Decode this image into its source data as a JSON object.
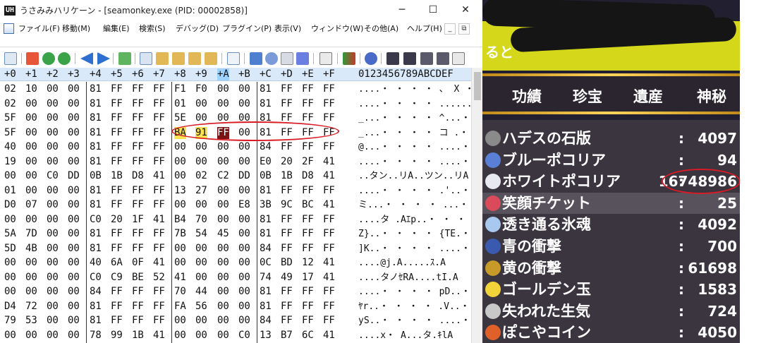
{
  "window": {
    "app_icon": "UH",
    "title": "うさみみハリケーン - [seamonkey.exe (PID: 00002858)]",
    "controls": [
      "─",
      "☐",
      "✕"
    ]
  },
  "menu": {
    "items": [
      "ファイル(F)",
      "移動(M)",
      "編集(E)",
      "検索(S)",
      "デバッグ(D)",
      "プラグイン(P)",
      "表示(V)",
      "ウィンドウ(W)",
      "その他(A)",
      "ヘルプ(H)"
    ],
    "mdi": [
      "_",
      "⧉"
    ]
  },
  "toolbar": {
    "icons": [
      "compare-icon",
      "marker-icon",
      "back-icon",
      "forward-icon",
      "prev-icon",
      "next-icon",
      "refresh-icon",
      "copy-icon",
      "paste-icon",
      "paste-special-icon",
      "paste-text-icon",
      "paste-hex-icon",
      "font-icon",
      "edit-icon",
      "settings-icon",
      "code-icon",
      "calc-icon",
      "calculator-icon",
      "color-icon",
      "plugin-icon",
      "binoculars-icon",
      "binoculars-next-icon",
      "replace-icon",
      "find-text-icon",
      "binary-icon"
    ]
  },
  "hex_header": {
    "columns": [
      "+0",
      "+1",
      "+2",
      "+3",
      "+4",
      "+5",
      "+6",
      "+7",
      "+8",
      "+9",
      "+A",
      "+B",
      "+C",
      "+D",
      "+E",
      "+F"
    ],
    "ascii": "0123456789ABCDEF"
  },
  "hex_rows": [
    {
      "bytes": [
        "02",
        "10",
        "00",
        "00",
        "81",
        "FF",
        "FF",
        "FF",
        "F1",
        "F0",
        "00",
        "00",
        "81",
        "FF",
        "FF",
        "FF"
      ],
      "ascii": "....・ ・ ・ ・ 、 X ・ ・ ・"
    },
    {
      "bytes": [
        "02",
        "00",
        "00",
        "00",
        "81",
        "FF",
        "FF",
        "FF",
        "01",
        "00",
        "00",
        "00",
        "81",
        "FF",
        "FF",
        "FF"
      ],
      "ascii": "....・ ・ ・ ・ .......・ ・ ・"
    },
    {
      "bytes": [
        "5F",
        "00",
        "00",
        "00",
        "81",
        "FF",
        "FF",
        "FF",
        "5E",
        "00",
        "00",
        "00",
        "81",
        "FF",
        "FF",
        "FF"
      ],
      "ascii": "_...・ ・ ・ ・ ^...・ ・ ・"
    },
    {
      "bytes": [
        "5F",
        "00",
        "00",
        "00",
        "81",
        "FF",
        "FF",
        "FF",
        "BA",
        "91",
        "FF",
        "00",
        "81",
        "FF",
        "FF",
        "FF"
      ],
      "ascii": "_...・ ・ ・ ・ コ .・ .・ ・ ・"
    },
    {
      "bytes": [
        "40",
        "00",
        "00",
        "00",
        "81",
        "FF",
        "FF",
        "FF",
        "00",
        "00",
        "00",
        "00",
        "84",
        "FF",
        "FF",
        "FF"
      ],
      "ascii": "@...・ ・ ・ ・ ....・ ・ ・ ・"
    },
    {
      "bytes": [
        "19",
        "00",
        "00",
        "00",
        "81",
        "FF",
        "FF",
        "FF",
        "00",
        "00",
        "00",
        "00",
        "E0",
        "20",
        "2F",
        "41"
      ],
      "ascii": "....・ ・ ・ ・ ....・ /A"
    },
    {
      "bytes": [
        "00",
        "00",
        "C0",
        "DD",
        "0B",
        "1B",
        "D8",
        "41",
        "00",
        "02",
        "C2",
        "DD",
        "0B",
        "1B",
        "D8",
        "41"
      ],
      "ascii": "..タン..リA..ツン..リA"
    },
    {
      "bytes": [
        "01",
        "00",
        "00",
        "00",
        "81",
        "FF",
        "FF",
        "FF",
        "13",
        "27",
        "00",
        "00",
        "81",
        "FF",
        "FF",
        "FF"
      ],
      "ascii": "....・ ・ ・ ・ .'..・ ・ ・"
    },
    {
      "bytes": [
        "D0",
        "07",
        "00",
        "00",
        "81",
        "FF",
        "FF",
        "FF",
        "00",
        "00",
        "00",
        "E8",
        "3B",
        "9C",
        "BC",
        "41"
      ],
      "ascii": "ミ...・ ・ ・ ・ ...・ ;悠A"
    },
    {
      "bytes": [
        "00",
        "00",
        "00",
        "00",
        "C0",
        "20",
        "1F",
        "41",
        "B4",
        "70",
        "00",
        "00",
        "81",
        "FF",
        "FF",
        "FF"
      ],
      "ascii": "....タ .Aｴp..・ ・ ・"
    },
    {
      "bytes": [
        "5A",
        "7D",
        "00",
        "00",
        "81",
        "FF",
        "FF",
        "FF",
        "7B",
        "54",
        "45",
        "00",
        "81",
        "FF",
        "FF",
        "FF"
      ],
      "ascii": "Z}..・ ・ ・ ・ {TE.・ ・ ・"
    },
    {
      "bytes": [
        "5D",
        "4B",
        "00",
        "00",
        "81",
        "FF",
        "FF",
        "FF",
        "00",
        "00",
        "00",
        "00",
        "84",
        "FF",
        "FF",
        "FF"
      ],
      "ascii": "]K..・ ・ ・ ・ ....・ ・ ・ ・"
    },
    {
      "bytes": [
        "00",
        "00",
        "00",
        "00",
        "40",
        "6A",
        "0F",
        "41",
        "00",
        "00",
        "00",
        "00",
        "0C",
        "BD",
        "12",
        "41"
      ],
      "ascii": "....@j.A.....ｽ.A"
    },
    {
      "bytes": [
        "00",
        "00",
        "00",
        "00",
        "C0",
        "C9",
        "BE",
        "52",
        "41",
        "00",
        "00",
        "00",
        "74",
        "49",
        "17",
        "41"
      ],
      "ascii": "....タノｾRA....tI.A"
    },
    {
      "bytes": [
        "00",
        "00",
        "00",
        "00",
        "84",
        "FF",
        "FF",
        "FF",
        "70",
        "44",
        "00",
        "00",
        "81",
        "FF",
        "FF",
        "FF"
      ],
      "ascii": "....・ ・ ・ ・ pD..・ ・ ・"
    },
    {
      "bytes": [
        "D4",
        "72",
        "00",
        "00",
        "81",
        "FF",
        "FF",
        "FF",
        "FA",
        "56",
        "00",
        "00",
        "81",
        "FF",
        "FF",
        "FF"
      ],
      "ascii": "ﾔr..・ ・ ・ ・ .V..・ ・ ・"
    },
    {
      "bytes": [
        "79",
        "53",
        "00",
        "00",
        "81",
        "FF",
        "FF",
        "FF",
        "00",
        "00",
        "00",
        "00",
        "84",
        "FF",
        "FF",
        "FF"
      ],
      "ascii": "yS..・ ・ ・ ・ ....・ ・ ・ ・"
    },
    {
      "bytes": [
        "00",
        "00",
        "00",
        "00",
        "78",
        "99",
        "1B",
        "41",
        "00",
        "00",
        "00",
        "C0",
        "13",
        "B7",
        "6C",
        "41"
      ],
      "ascii": "....x・ A...タ.ｷlA"
    }
  ],
  "game": {
    "banner_text": "ると",
    "tabs": [
      "功績",
      "珍宝",
      "遺産",
      "神秘"
    ],
    "items": [
      {
        "name": "ハデスの石版",
        "qty": "4097",
        "icon_color": "#8a8a8a"
      },
      {
        "name": "ブルーポコリア",
        "qty": "94",
        "icon_color": "#5a7fd6"
      },
      {
        "name": "ホワイトポコリア",
        "qty": "16748986",
        "icon_color": "#e8e8f0"
      },
      {
        "name": "笑顔チケット",
        "qty": "25",
        "icon_color": "#d94a5a"
      },
      {
        "name": "透き通る氷魂",
        "qty": "4092",
        "icon_color": "#a8c8f0"
      },
      {
        "name": "青の衝撃",
        "qty": "700",
        "icon_color": "#3a5ab0"
      },
      {
        "name": "黄の衝撃",
        "qty": "61698",
        "icon_color": "#c89a2a"
      },
      {
        "name": "ゴールデン玉",
        "qty": "1583",
        "icon_color": "#f2d43a"
      },
      {
        "name": "失われた生気",
        "qty": "724",
        "icon_color": "#c8c8c8"
      },
      {
        "name": "ぽこやコイン",
        "qty": "4050",
        "icon_color": "#e0602a"
      }
    ],
    "colon": ":"
  }
}
